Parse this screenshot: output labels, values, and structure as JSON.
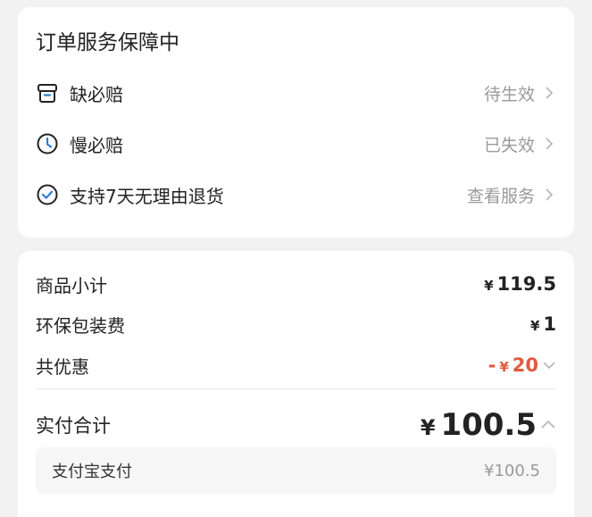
{
  "service_card": {
    "title": "订单服务保障中",
    "items": [
      {
        "icon": "box-icon",
        "label": "缺必赔",
        "status": "待生效"
      },
      {
        "icon": "clock-icon",
        "label": "慢必赔",
        "status": "已失效"
      },
      {
        "icon": "check-circle-icon",
        "label": "支持7天无理由退货",
        "status": "查看服务"
      }
    ]
  },
  "price_card": {
    "subtotal": {
      "label": "商品小计",
      "currency": "¥",
      "amount": "119.5"
    },
    "packaging": {
      "label": "环保包装费",
      "currency": "¥",
      "amount": "1"
    },
    "discount": {
      "label": "共优惠",
      "prefix": "-",
      "currency": "¥",
      "amount": "20",
      "color": "#e05a3c"
    },
    "total": {
      "label": "实付合计",
      "currency": "¥",
      "amount": "100.5"
    },
    "payment": {
      "label": "支付宝支付",
      "value": "¥100.5"
    }
  }
}
